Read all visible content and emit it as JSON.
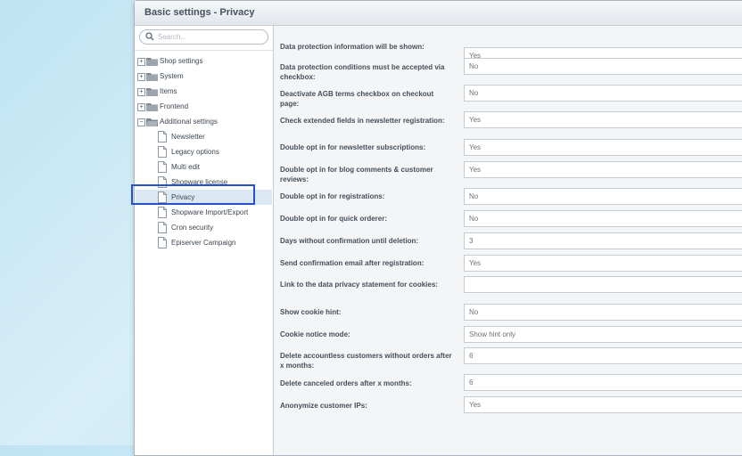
{
  "window": {
    "title": "Basic settings - Privacy"
  },
  "search": {
    "placeholder": "Search..."
  },
  "tree": {
    "roots": [
      {
        "label": "Shop settings",
        "toggle": "+"
      },
      {
        "label": "System",
        "toggle": "+"
      },
      {
        "label": "Items",
        "toggle": "+"
      },
      {
        "label": "Frontend",
        "toggle": "+"
      },
      {
        "label": "Additional settings",
        "toggle": "−"
      }
    ],
    "children": [
      {
        "label": "Newsletter"
      },
      {
        "label": "Legacy options"
      },
      {
        "label": "Multi edit"
      },
      {
        "label": "Shopware license"
      },
      {
        "label": "Privacy"
      },
      {
        "label": "Shopware Import/Export"
      },
      {
        "label": "Cron security"
      },
      {
        "label": "Episerver Campaign"
      }
    ]
  },
  "form": {
    "fields": [
      {
        "label": "Data protection information will be shown:",
        "value": "Yes"
      },
      {
        "label": "Data protection conditions must be accepted via checkbox:",
        "value": "No"
      },
      {
        "label": "Deactivate AGB terms checkbox on checkout page:",
        "value": "No"
      },
      {
        "label": "Check extended fields in newsletter registration:",
        "value": "Yes"
      },
      {
        "label": "Double opt in for newsletter subscriptions:",
        "value": "Yes"
      },
      {
        "label": "Double opt in for blog comments & customer reviews:",
        "value": "Yes"
      },
      {
        "label": "Double opt in for registrations:",
        "value": "No"
      },
      {
        "label": "Double opt in for quick orderer:",
        "value": "No"
      },
      {
        "label": "Days without confirmation until deletion:",
        "value": "3"
      },
      {
        "label": "Send confirmation email after registration:",
        "value": "Yes"
      },
      {
        "label": "Link to the data privacy statement for cookies:",
        "value": ""
      },
      {
        "label": "Show cookie hint:",
        "value": "No"
      },
      {
        "label": "Cookie notice mode:",
        "value": "Show hint only"
      },
      {
        "label": "Delete accountless customers without orders after x months:",
        "value": "6"
      },
      {
        "label": "Delete canceled orders after x months:",
        "value": "6"
      },
      {
        "label": "Anonymize customer IPs:",
        "value": "Yes"
      }
    ]
  }
}
